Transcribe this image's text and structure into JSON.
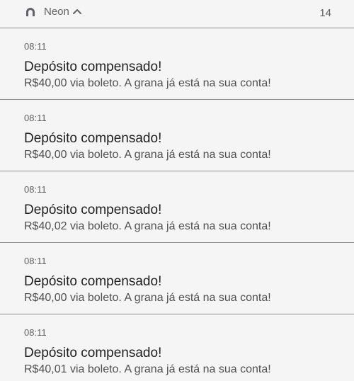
{
  "header": {
    "app_name": "Neon",
    "count": "14",
    "app_icon": "neon-logo-icon",
    "expand_icon": "chevron-up-icon"
  },
  "notifications": [
    {
      "time": "08:11",
      "title": "Depósito compensado!",
      "body": "R$40,00 via boleto. A grana já está na sua conta!"
    },
    {
      "time": "08:11",
      "title": "Depósito compensado!",
      "body": "R$40,00 via boleto. A grana já está na sua conta!"
    },
    {
      "time": "08:11",
      "title": "Depósito compensado!",
      "body": "R$40,02 via boleto. A grana já está na sua conta!"
    },
    {
      "time": "08:11",
      "title": "Depósito compensado!",
      "body": "R$40,00 via boleto. A grana já está na sua conta!"
    },
    {
      "time": "08:11",
      "title": "Depósito compensado!",
      "body": "R$40,01 via boleto. A grana já está na sua conta!"
    }
  ]
}
